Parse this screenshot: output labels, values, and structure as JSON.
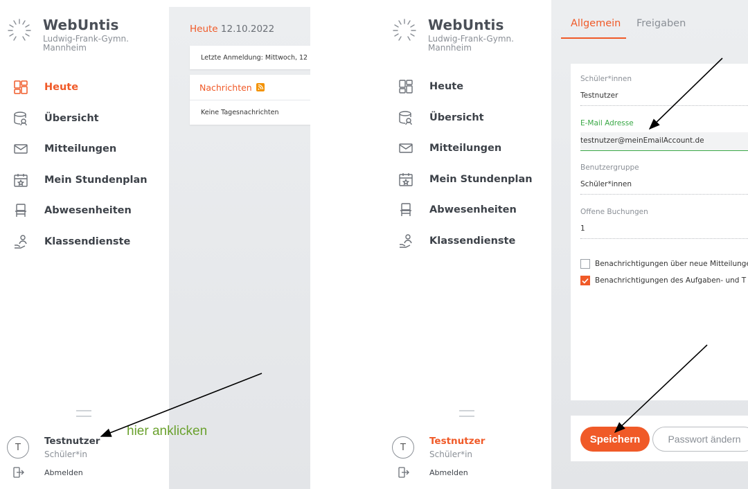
{
  "left": {
    "brand": {
      "title": "WebUntis",
      "school_line1": "Ludwig-Frank-Gymn.",
      "school_line2": "Mannheim"
    },
    "nav": [
      {
        "label": "Heute",
        "icon": "dashboard-icon",
        "active": true
      },
      {
        "label": "Übersicht",
        "icon": "overview-icon",
        "active": false
      },
      {
        "label": "Mitteilungen",
        "icon": "mail-icon",
        "active": false
      },
      {
        "label": "Mein Stundenplan",
        "icon": "calendar-icon",
        "active": false
      },
      {
        "label": "Abwesenheiten",
        "icon": "chair-icon",
        "active": false
      },
      {
        "label": "Klassendienste",
        "icon": "person-hand-icon",
        "active": false
      }
    ],
    "user": {
      "initial": "T",
      "name": "Testnutzer",
      "role": "Schüler*in",
      "logout": "Abmelden"
    },
    "today": {
      "label": "Heute",
      "date": "12.10.2022"
    },
    "login_info": "Letzte Anmeldung: Mittwoch, 12",
    "news": {
      "title": "Nachrichten",
      "empty": "Keine Tagesnachrichten"
    },
    "hint": "hier anklicken"
  },
  "right": {
    "brand": {
      "title": "WebUntis",
      "school_line1": "Ludwig-Frank-Gymn.",
      "school_line2": "Mannheim"
    },
    "nav": [
      {
        "label": "Heute",
        "icon": "dashboard-icon"
      },
      {
        "label": "Übersicht",
        "icon": "overview-icon"
      },
      {
        "label": "Mitteilungen",
        "icon": "mail-icon"
      },
      {
        "label": "Mein Stundenplan",
        "icon": "calendar-icon"
      },
      {
        "label": "Abwesenheiten",
        "icon": "chair-icon"
      },
      {
        "label": "Klassendienste",
        "icon": "person-hand-icon"
      }
    ],
    "user": {
      "initial": "T",
      "name": "Testnutzer",
      "role": "Schüler*in",
      "logout": "Abmelden"
    },
    "tabs": [
      {
        "label": "Allgemein",
        "active": true
      },
      {
        "label": "Freigaben",
        "active": false
      }
    ],
    "form": {
      "fields": [
        {
          "label": "Schüler*innen",
          "value": "Testnutzer"
        },
        {
          "label": "E-Mail Adresse",
          "value": "testnutzer@meinEmailAccount.de"
        },
        {
          "label": "Benutzergruppe",
          "value": "Schüler*innen"
        },
        {
          "label": "Offene Buchungen",
          "value": "1"
        }
      ],
      "checkboxes": [
        {
          "label": "Benachrichtigungen über neue Mitteilunge",
          "checked": false
        },
        {
          "label": "Benachrichtigungen des Aufgaben- und T",
          "checked": true
        }
      ]
    },
    "buttons": {
      "save": "Speichern",
      "password": "Passwort ändern"
    }
  },
  "colors": {
    "accent": "#f05a28",
    "focus": "#39a845",
    "hint": "#6aa12e"
  }
}
